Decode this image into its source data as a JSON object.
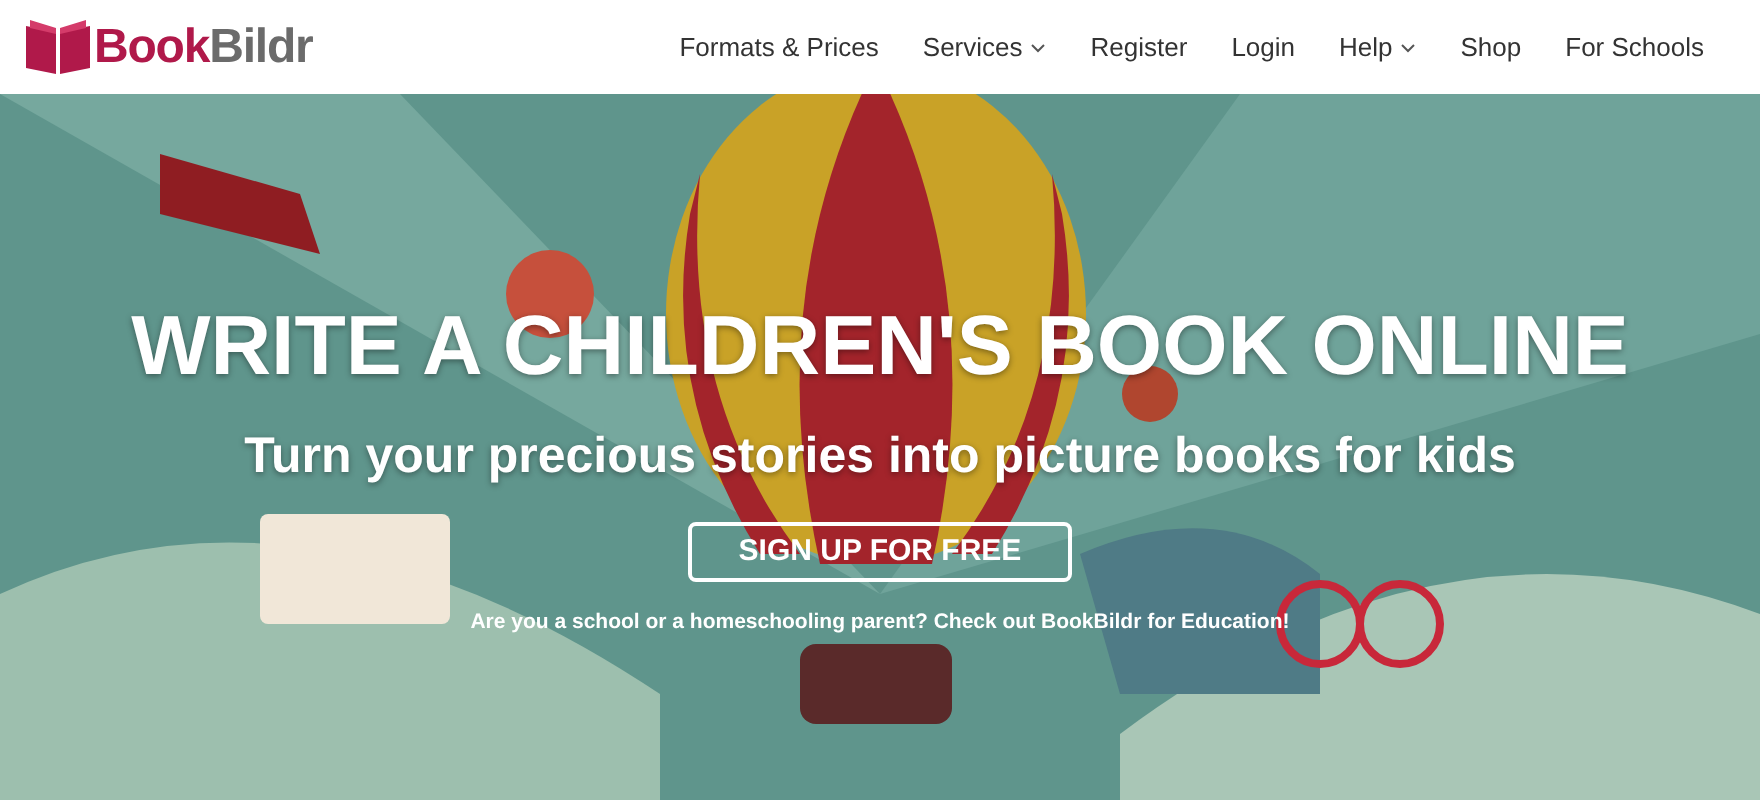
{
  "header": {
    "logo": {
      "first": "Book",
      "second": "Bildr"
    },
    "nav": [
      {
        "label": "Formats & Prices",
        "dropdown": false
      },
      {
        "label": "Services",
        "dropdown": true
      },
      {
        "label": "Register",
        "dropdown": false
      },
      {
        "label": "Login",
        "dropdown": false
      },
      {
        "label": "Help",
        "dropdown": true
      },
      {
        "label": "Shop",
        "dropdown": false
      },
      {
        "label": "For Schools",
        "dropdown": false
      }
    ]
  },
  "hero": {
    "title": "WRITE A CHILDREN'S BOOK ONLINE",
    "subtitle": "Turn your precious stories into picture books for kids",
    "button": "SIGN UP FOR FREE",
    "note": "Are you a school or a homeschooling parent? Check out BookBildr for Education!"
  }
}
